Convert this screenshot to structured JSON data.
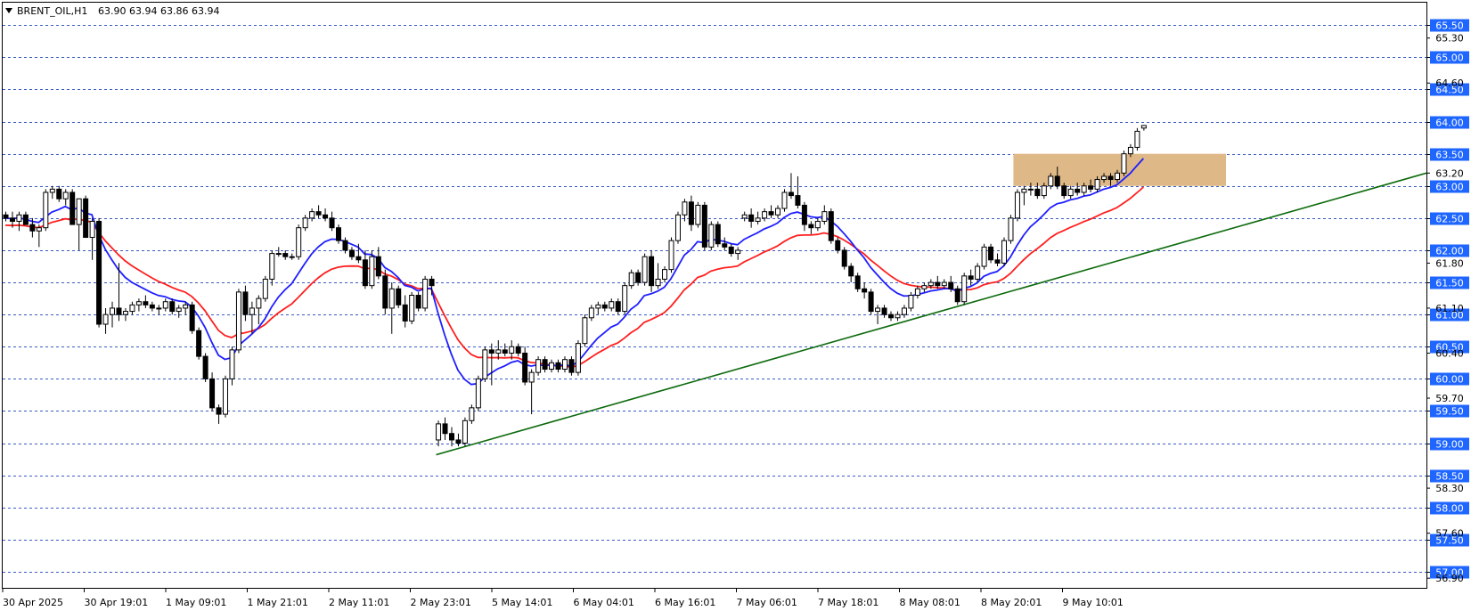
{
  "header": {
    "symbol": "BRENT_OIL,H1",
    "ohlc": "63.90 63.94 63.86 63.94"
  },
  "colors": {
    "grid": "#3b5bc4",
    "ema_fast": "#1f1fff",
    "ema_slow": "#ff1f1f",
    "trendline": "#0e6b0e",
    "zone": "#deb887",
    "label_bg": "#1e66ff",
    "bull_fill": "#ffffff",
    "bear_fill": "#000000"
  },
  "chart_data": {
    "type": "candlestick",
    "ylim": [
      56.75,
      65.85
    ],
    "grid_levels": [
      65.5,
      65.0,
      64.5,
      64.0,
      63.5,
      63.0,
      62.5,
      62.0,
      61.5,
      61.0,
      60.5,
      60.0,
      59.5,
      59.0,
      58.5,
      58.0,
      57.5,
      57.0
    ],
    "highlighted_labels": [
      "65.50",
      "65.00",
      "64.50",
      "64.00",
      "63.50",
      "63.00",
      "62.50",
      "62.00",
      "61.50",
      "61.00",
      "60.50",
      "60.00",
      "59.50",
      "59.00",
      "58.50",
      "58.00",
      "57.50",
      "57.00"
    ],
    "plain_labels": [
      {
        "value": 65.3,
        "text": "65.30"
      },
      {
        "value": 64.6,
        "text": "64.60"
      },
      {
        "value": 63.2,
        "text": "63.20"
      },
      {
        "value": 61.8,
        "text": "61.80"
      },
      {
        "value": 61.1,
        "text": "61.10"
      },
      {
        "value": 60.4,
        "text": "60.40"
      },
      {
        "value": 59.7,
        "text": "59.70"
      },
      {
        "value": 58.3,
        "text": "58.30"
      },
      {
        "value": 57.6,
        "text": "57.60"
      },
      {
        "value": 56.9,
        "text": "56.90"
      }
    ],
    "x_labels": [
      "30 Apr 2025",
      "30 Apr 19:01",
      "1 May 09:01",
      "1 May 21:01",
      "2 May 11:01",
      "2 May 23:01",
      "5 May 14:01",
      "6 May 04:01",
      "6 May 16:01",
      "7 May 06:01",
      "7 May 18:01",
      "8 May 08:01",
      "8 May 20:01",
      "9 May 10:01"
    ],
    "candles": [
      {
        "o": 62.55,
        "h": 62.6,
        "l": 62.45,
        "c": 62.5
      },
      {
        "o": 62.5,
        "h": 62.6,
        "l": 62.35,
        "c": 62.45
      },
      {
        "o": 62.45,
        "h": 62.6,
        "l": 62.3,
        "c": 62.55
      },
      {
        "o": 62.55,
        "h": 62.6,
        "l": 62.4,
        "c": 62.4
      },
      {
        "o": 62.4,
        "h": 62.5,
        "l": 62.2,
        "c": 62.3
      },
      {
        "o": 62.3,
        "h": 62.4,
        "l": 62.05,
        "c": 62.35
      },
      {
        "o": 62.35,
        "h": 62.95,
        "l": 62.3,
        "c": 62.9
      },
      {
        "o": 62.9,
        "h": 63.0,
        "l": 62.8,
        "c": 62.95
      },
      {
        "o": 62.95,
        "h": 63.0,
        "l": 62.75,
        "c": 62.8
      },
      {
        "o": 62.8,
        "h": 62.95,
        "l": 62.7,
        "c": 62.9
      },
      {
        "o": 62.9,
        "h": 62.95,
        "l": 62.4,
        "c": 62.4
      },
      {
        "o": 62.4,
        "h": 62.8,
        "l": 62.0,
        "c": 62.8
      },
      {
        "o": 62.8,
        "h": 62.85,
        "l": 62.2,
        "c": 62.2
      },
      {
        "o": 62.2,
        "h": 62.5,
        "l": 61.85,
        "c": 62.45
      },
      {
        "o": 62.45,
        "h": 62.5,
        "l": 60.8,
        "c": 60.85
      },
      {
        "o": 60.85,
        "h": 61.1,
        "l": 60.7,
        "c": 61.0
      },
      {
        "o": 61.0,
        "h": 61.2,
        "l": 60.8,
        "c": 61.1
      },
      {
        "o": 61.1,
        "h": 61.8,
        "l": 60.9,
        "c": 61.0
      },
      {
        "o": 61.0,
        "h": 61.1,
        "l": 60.9,
        "c": 61.05
      },
      {
        "o": 61.05,
        "h": 61.2,
        "l": 61.0,
        "c": 61.15
      },
      {
        "o": 61.15,
        "h": 61.25,
        "l": 61.05,
        "c": 61.2
      },
      {
        "o": 61.2,
        "h": 61.3,
        "l": 61.1,
        "c": 61.15
      },
      {
        "o": 61.15,
        "h": 61.2,
        "l": 61.05,
        "c": 61.1
      },
      {
        "o": 61.1,
        "h": 61.15,
        "l": 61.0,
        "c": 61.1
      },
      {
        "o": 61.1,
        "h": 61.25,
        "l": 61.05,
        "c": 61.2
      },
      {
        "o": 61.2,
        "h": 61.25,
        "l": 61.0,
        "c": 61.05
      },
      {
        "o": 61.05,
        "h": 61.15,
        "l": 60.95,
        "c": 61.1
      },
      {
        "o": 61.1,
        "h": 61.2,
        "l": 61.0,
        "c": 61.15
      },
      {
        "o": 61.15,
        "h": 61.2,
        "l": 60.7,
        "c": 60.75
      },
      {
        "o": 60.75,
        "h": 60.8,
        "l": 60.3,
        "c": 60.35
      },
      {
        "o": 60.35,
        "h": 60.4,
        "l": 59.95,
        "c": 60.0
      },
      {
        "o": 60.0,
        "h": 60.1,
        "l": 59.5,
        "c": 59.55
      },
      {
        "o": 59.55,
        "h": 59.6,
        "l": 59.3,
        "c": 59.45
      },
      {
        "o": 59.45,
        "h": 60.05,
        "l": 59.4,
        "c": 60.0
      },
      {
        "o": 60.0,
        "h": 60.5,
        "l": 59.9,
        "c": 60.45
      },
      {
        "o": 60.45,
        "h": 61.4,
        "l": 60.4,
        "c": 61.35
      },
      {
        "o": 61.35,
        "h": 61.45,
        "l": 60.9,
        "c": 61.0
      },
      {
        "o": 61.0,
        "h": 61.2,
        "l": 60.7,
        "c": 61.1
      },
      {
        "o": 61.1,
        "h": 61.3,
        "l": 60.85,
        "c": 61.25
      },
      {
        "o": 61.25,
        "h": 61.6,
        "l": 61.2,
        "c": 61.55
      },
      {
        "o": 61.55,
        "h": 62.0,
        "l": 61.45,
        "c": 61.95
      },
      {
        "o": 61.95,
        "h": 62.05,
        "l": 61.9,
        "c": 61.95
      },
      {
        "o": 61.95,
        "h": 62.0,
        "l": 61.85,
        "c": 61.9
      },
      {
        "o": 61.9,
        "h": 61.95,
        "l": 61.85,
        "c": 61.9
      },
      {
        "o": 61.9,
        "h": 62.4,
        "l": 61.85,
        "c": 62.35
      },
      {
        "o": 62.35,
        "h": 62.55,
        "l": 62.3,
        "c": 62.5
      },
      {
        "o": 62.5,
        "h": 62.65,
        "l": 62.45,
        "c": 62.6
      },
      {
        "o": 62.6,
        "h": 62.7,
        "l": 62.5,
        "c": 62.55
      },
      {
        "o": 62.55,
        "h": 62.65,
        "l": 62.45,
        "c": 62.5
      },
      {
        "o": 62.5,
        "h": 62.6,
        "l": 62.3,
        "c": 62.35
      },
      {
        "o": 62.35,
        "h": 62.4,
        "l": 62.1,
        "c": 62.15
      },
      {
        "o": 62.15,
        "h": 62.2,
        "l": 61.95,
        "c": 62.0
      },
      {
        "o": 62.0,
        "h": 62.05,
        "l": 61.85,
        "c": 61.9
      },
      {
        "o": 61.9,
        "h": 62.1,
        "l": 61.8,
        "c": 61.85
      },
      {
        "o": 61.85,
        "h": 62.0,
        "l": 61.4,
        "c": 61.45
      },
      {
        "o": 61.45,
        "h": 62.0,
        "l": 61.4,
        "c": 61.9
      },
      {
        "o": 61.9,
        "h": 62.05,
        "l": 61.55,
        "c": 61.6
      },
      {
        "o": 61.6,
        "h": 61.7,
        "l": 61.0,
        "c": 61.1
      },
      {
        "o": 61.1,
        "h": 61.5,
        "l": 60.7,
        "c": 61.4
      },
      {
        "o": 61.4,
        "h": 61.45,
        "l": 61.1,
        "c": 61.15
      },
      {
        "o": 61.15,
        "h": 61.3,
        "l": 60.8,
        "c": 60.9
      },
      {
        "o": 60.9,
        "h": 61.35,
        "l": 60.85,
        "c": 61.3
      },
      {
        "o": 61.3,
        "h": 61.35,
        "l": 61.05,
        "c": 61.1
      },
      {
        "o": 61.1,
        "h": 61.6,
        "l": 61.05,
        "c": 61.55
      },
      {
        "o": 61.55,
        "h": 61.6,
        "l": 61.3,
        "c": 61.45
      },
      {
        "o": 59.05,
        "h": 59.35,
        "l": 58.95,
        "c": 59.3
      },
      {
        "o": 59.3,
        "h": 59.4,
        "l": 59.05,
        "c": 59.15
      },
      {
        "o": 59.15,
        "h": 59.25,
        "l": 58.95,
        "c": 59.05
      },
      {
        "o": 59.05,
        "h": 59.15,
        "l": 58.95,
        "c": 59.0
      },
      {
        "o": 59.0,
        "h": 59.4,
        "l": 58.95,
        "c": 59.35
      },
      {
        "o": 59.35,
        "h": 59.6,
        "l": 59.3,
        "c": 59.55
      },
      {
        "o": 59.55,
        "h": 60.05,
        "l": 59.5,
        "c": 60.0
      },
      {
        "o": 60.0,
        "h": 60.5,
        "l": 59.95,
        "c": 60.45
      },
      {
        "o": 60.45,
        "h": 60.55,
        "l": 59.9,
        "c": 60.4
      },
      {
        "o": 60.4,
        "h": 60.6,
        "l": 60.3,
        "c": 60.45
      },
      {
        "o": 60.45,
        "h": 60.55,
        "l": 60.35,
        "c": 60.4
      },
      {
        "o": 60.4,
        "h": 60.6,
        "l": 60.3,
        "c": 60.5
      },
      {
        "o": 60.5,
        "h": 60.55,
        "l": 60.35,
        "c": 60.4
      },
      {
        "o": 60.4,
        "h": 60.5,
        "l": 59.9,
        "c": 59.95
      },
      {
        "o": 59.95,
        "h": 60.15,
        "l": 59.45,
        "c": 60.1
      },
      {
        "o": 60.1,
        "h": 60.35,
        "l": 60.05,
        "c": 60.3
      },
      {
        "o": 60.3,
        "h": 60.35,
        "l": 60.1,
        "c": 60.15
      },
      {
        "o": 60.15,
        "h": 60.3,
        "l": 60.1,
        "c": 60.25
      },
      {
        "o": 60.25,
        "h": 60.3,
        "l": 60.1,
        "c": 60.15
      },
      {
        "o": 60.15,
        "h": 60.35,
        "l": 60.1,
        "c": 60.3
      },
      {
        "o": 60.3,
        "h": 60.35,
        "l": 60.05,
        "c": 60.1
      },
      {
        "o": 60.1,
        "h": 60.6,
        "l": 60.05,
        "c": 60.55
      },
      {
        "o": 60.55,
        "h": 61.0,
        "l": 60.5,
        "c": 60.95
      },
      {
        "o": 60.95,
        "h": 61.15,
        "l": 60.9,
        "c": 61.1
      },
      {
        "o": 61.1,
        "h": 61.2,
        "l": 61.0,
        "c": 61.15
      },
      {
        "o": 61.15,
        "h": 61.2,
        "l": 61.05,
        "c": 61.1
      },
      {
        "o": 61.1,
        "h": 61.25,
        "l": 61.05,
        "c": 61.2
      },
      {
        "o": 61.2,
        "h": 61.25,
        "l": 61.0,
        "c": 61.05
      },
      {
        "o": 61.05,
        "h": 61.5,
        "l": 61.0,
        "c": 61.45
      },
      {
        "o": 61.45,
        "h": 61.7,
        "l": 61.4,
        "c": 61.65
      },
      {
        "o": 61.65,
        "h": 61.7,
        "l": 61.45,
        "c": 61.5
      },
      {
        "o": 61.5,
        "h": 61.95,
        "l": 61.45,
        "c": 61.9
      },
      {
        "o": 61.9,
        "h": 62.0,
        "l": 61.35,
        "c": 61.45
      },
      {
        "o": 61.45,
        "h": 61.8,
        "l": 61.4,
        "c": 61.55
      },
      {
        "o": 61.55,
        "h": 61.75,
        "l": 61.5,
        "c": 61.7
      },
      {
        "o": 61.7,
        "h": 62.2,
        "l": 61.65,
        "c": 62.15
      },
      {
        "o": 62.15,
        "h": 62.6,
        "l": 62.1,
        "c": 62.55
      },
      {
        "o": 62.55,
        "h": 62.8,
        "l": 62.45,
        "c": 62.75
      },
      {
        "o": 62.75,
        "h": 62.85,
        "l": 62.3,
        "c": 62.4
      },
      {
        "o": 62.4,
        "h": 62.75,
        "l": 62.35,
        "c": 62.7
      },
      {
        "o": 62.7,
        "h": 62.75,
        "l": 62.0,
        "c": 62.05
      },
      {
        "o": 62.05,
        "h": 62.45,
        "l": 62.0,
        "c": 62.4
      },
      {
        "o": 62.4,
        "h": 62.45,
        "l": 62.05,
        "c": 62.1
      },
      {
        "o": 62.1,
        "h": 62.2,
        "l": 62.0,
        "c": 62.05
      },
      {
        "o": 62.05,
        "h": 62.1,
        "l": 61.9,
        "c": 61.95
      },
      {
        "o": 61.95,
        "h": 62.05,
        "l": 61.85,
        "c": 62.0
      },
      {
        "o": 62.5,
        "h": 62.6,
        "l": 62.45,
        "c": 62.55
      },
      {
        "o": 62.55,
        "h": 62.65,
        "l": 62.35,
        "c": 62.45
      },
      {
        "o": 62.45,
        "h": 62.6,
        "l": 62.4,
        "c": 62.5
      },
      {
        "o": 62.5,
        "h": 62.65,
        "l": 62.45,
        "c": 62.6
      },
      {
        "o": 62.6,
        "h": 62.7,
        "l": 62.5,
        "c": 62.55
      },
      {
        "o": 62.55,
        "h": 62.7,
        "l": 62.5,
        "c": 62.65
      },
      {
        "o": 62.65,
        "h": 62.95,
        "l": 62.6,
        "c": 62.9
      },
      {
        "o": 62.9,
        "h": 63.2,
        "l": 62.8,
        "c": 62.85
      },
      {
        "o": 62.85,
        "h": 63.15,
        "l": 62.65,
        "c": 62.7
      },
      {
        "o": 62.7,
        "h": 62.75,
        "l": 62.3,
        "c": 62.4
      },
      {
        "o": 62.4,
        "h": 62.45,
        "l": 62.25,
        "c": 62.35
      },
      {
        "o": 62.35,
        "h": 62.5,
        "l": 62.3,
        "c": 62.45
      },
      {
        "o": 62.45,
        "h": 62.7,
        "l": 62.4,
        "c": 62.6
      },
      {
        "o": 62.6,
        "h": 62.65,
        "l": 62.1,
        "c": 62.15
      },
      {
        "o": 62.15,
        "h": 62.2,
        "l": 61.95,
        "c": 62.0
      },
      {
        "o": 62.0,
        "h": 62.05,
        "l": 61.7,
        "c": 61.75
      },
      {
        "o": 61.75,
        "h": 61.8,
        "l": 61.5,
        "c": 61.6
      },
      {
        "o": 61.6,
        "h": 61.65,
        "l": 61.35,
        "c": 61.4
      },
      {
        "o": 61.4,
        "h": 61.5,
        "l": 61.25,
        "c": 61.35
      },
      {
        "o": 61.35,
        "h": 61.4,
        "l": 61.0,
        "c": 61.05
      },
      {
        "o": 61.05,
        "h": 61.15,
        "l": 60.85,
        "c": 61.1
      },
      {
        "o": 61.1,
        "h": 61.15,
        "l": 60.95,
        "c": 61.0
      },
      {
        "o": 61.0,
        "h": 61.05,
        "l": 60.9,
        "c": 60.95
      },
      {
        "o": 60.95,
        "h": 61.05,
        "l": 60.9,
        "c": 61.0
      },
      {
        "o": 61.0,
        "h": 61.15,
        "l": 60.95,
        "c": 61.1
      },
      {
        "o": 61.1,
        "h": 61.35,
        "l": 61.05,
        "c": 61.3
      },
      {
        "o": 61.3,
        "h": 61.45,
        "l": 61.25,
        "c": 61.4
      },
      {
        "o": 61.4,
        "h": 61.5,
        "l": 61.35,
        "c": 61.45
      },
      {
        "o": 61.45,
        "h": 61.55,
        "l": 61.4,
        "c": 61.5
      },
      {
        "o": 61.5,
        "h": 61.6,
        "l": 61.4,
        "c": 61.45
      },
      {
        "o": 61.45,
        "h": 61.55,
        "l": 61.4,
        "c": 61.5
      },
      {
        "o": 61.5,
        "h": 61.6,
        "l": 61.35,
        "c": 61.4
      },
      {
        "o": 61.4,
        "h": 61.45,
        "l": 61.15,
        "c": 61.2
      },
      {
        "o": 61.2,
        "h": 61.65,
        "l": 61.15,
        "c": 61.6
      },
      {
        "o": 61.6,
        "h": 61.7,
        "l": 61.45,
        "c": 61.55
      },
      {
        "o": 61.55,
        "h": 61.8,
        "l": 61.5,
        "c": 61.75
      },
      {
        "o": 61.75,
        "h": 62.1,
        "l": 61.7,
        "c": 62.05
      },
      {
        "o": 62.05,
        "h": 62.1,
        "l": 61.8,
        "c": 61.85
      },
      {
        "o": 61.85,
        "h": 61.95,
        "l": 61.75,
        "c": 61.8
      },
      {
        "o": 61.8,
        "h": 62.2,
        "l": 61.75,
        "c": 62.15
      },
      {
        "o": 62.15,
        "h": 62.55,
        "l": 62.1,
        "c": 62.5
      },
      {
        "o": 62.5,
        "h": 62.95,
        "l": 62.45,
        "c": 62.9
      },
      {
        "o": 62.9,
        "h": 63.0,
        "l": 62.7,
        "c": 62.95
      },
      {
        "o": 62.95,
        "h": 63.05,
        "l": 62.85,
        "c": 62.95
      },
      {
        "o": 62.95,
        "h": 63.05,
        "l": 62.8,
        "c": 62.85
      },
      {
        "o": 62.85,
        "h": 63.05,
        "l": 62.8,
        "c": 63.0
      },
      {
        "o": 63.0,
        "h": 63.2,
        "l": 62.95,
        "c": 63.15
      },
      {
        "o": 63.15,
        "h": 63.3,
        "l": 62.95,
        "c": 63.0
      },
      {
        "o": 63.0,
        "h": 63.05,
        "l": 62.8,
        "c": 62.85
      },
      {
        "o": 62.85,
        "h": 63.0,
        "l": 62.8,
        "c": 62.95
      },
      {
        "o": 62.95,
        "h": 63.05,
        "l": 62.85,
        "c": 62.9
      },
      {
        "o": 62.9,
        "h": 63.05,
        "l": 62.85,
        "c": 63.0
      },
      {
        "o": 63.0,
        "h": 63.1,
        "l": 62.9,
        "c": 62.95
      },
      {
        "o": 62.95,
        "h": 63.15,
        "l": 62.9,
        "c": 63.1
      },
      {
        "o": 63.1,
        "h": 63.2,
        "l": 63.05,
        "c": 63.15
      },
      {
        "o": 63.15,
        "h": 63.2,
        "l": 63.0,
        "c": 63.1
      },
      {
        "o": 63.1,
        "h": 63.25,
        "l": 63.05,
        "c": 63.2
      },
      {
        "o": 63.2,
        "h": 63.55,
        "l": 63.15,
        "c": 63.5
      },
      {
        "o": 63.5,
        "h": 63.65,
        "l": 63.45,
        "c": 63.6
      },
      {
        "o": 63.6,
        "h": 63.9,
        "l": 63.55,
        "c": 63.85
      },
      {
        "o": 63.9,
        "h": 63.94,
        "l": 63.86,
        "c": 63.94
      }
    ],
    "ema_fast_period": 10,
    "ema_slow_period": 20,
    "trendline": {
      "from": {
        "candle": 65,
        "price": 58.82
      },
      "to_price_at_right_edge": 63.2
    },
    "resistance_zone": {
      "low": 63.0,
      "high": 63.5,
      "from_candle": 152
    }
  }
}
